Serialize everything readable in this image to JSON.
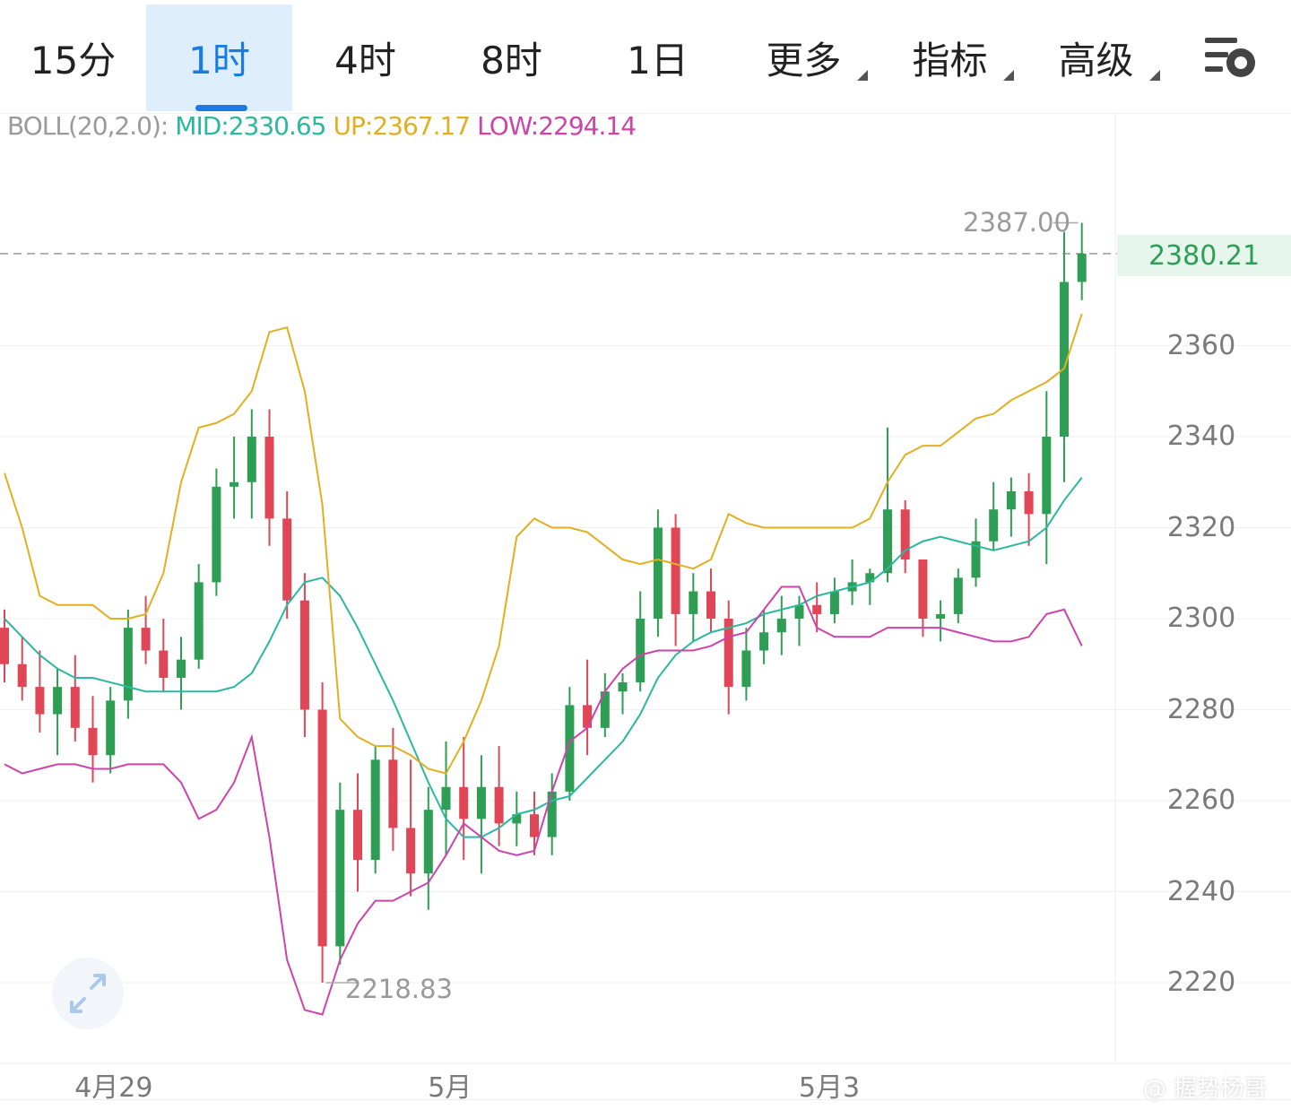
{
  "tabs": [
    {
      "label": "15分",
      "active": false,
      "dropdown": false
    },
    {
      "label": "1时",
      "active": true,
      "dropdown": false
    },
    {
      "label": "4时",
      "active": false,
      "dropdown": false
    },
    {
      "label": "8时",
      "active": false,
      "dropdown": false
    },
    {
      "label": "1日",
      "active": false,
      "dropdown": false
    },
    {
      "label": "更多",
      "active": false,
      "dropdown": true
    },
    {
      "label": "指标",
      "active": false,
      "dropdown": true
    },
    {
      "label": "高级",
      "active": false,
      "dropdown": true
    }
  ],
  "settings_icon": "chart-settings-icon",
  "indicator": {
    "name": "BOLL(20,2.0):",
    "mid": "MID:2330.65",
    "up": "UP:2367.17",
    "low": "LOW:2294.14",
    "colors": {
      "name": "#9a9a9a",
      "mid": "#2bb8a0",
      "up": "#e0b020",
      "low": "#cc44aa"
    }
  },
  "current_price": "2380.21",
  "high_label": "2387.00",
  "low_label": "2218.83",
  "watermark": "@ 握势杨哥",
  "expand_icon": "expand-arrows-icon",
  "colors": {
    "up": "#2e9e55",
    "down": "#e04656",
    "mid": "#2bb8a0",
    "upper": "#e0b020",
    "lower": "#cc44aa",
    "accent": "#1a7ce0"
  },
  "chart_data": {
    "type": "candlestick",
    "y_ticks": [
      "2360",
      "2340",
      "2320",
      "2300",
      "2280",
      "2260",
      "2240",
      "2220"
    ],
    "x_ticks": [
      "4月29",
      "5月",
      "5月3"
    ],
    "ylim": [
      2207,
      2390
    ],
    "grid": true,
    "series": [
      {
        "name": "MID",
        "values": [
          2300,
          2296,
          2292,
          2289,
          2287,
          2287,
          2286,
          2285,
          2284,
          2284,
          2284,
          2284,
          2284,
          2285,
          2288,
          2295,
          2303,
          2308,
          2309,
          2305,
          2298,
          2290,
          2282,
          2273,
          2264,
          2256,
          2252,
          2252,
          2254,
          2257,
          2258,
          2260,
          2261,
          2265,
          2269,
          2273,
          2279,
          2287,
          2292,
          2295,
          2297,
          2298,
          2299,
          2301,
          2302,
          2303,
          2305,
          2306,
          2307,
          2308,
          2311,
          2315,
          2317,
          2318,
          2317,
          2316,
          2315,
          2316,
          2317,
          2320,
          2326,
          2331
        ]
      },
      {
        "name": "UP",
        "values": [
          2332,
          2320,
          2305,
          2303,
          2303,
          2303,
          2300,
          2300,
          2301,
          2310,
          2330,
          2342,
          2343,
          2345,
          2350,
          2363,
          2364,
          2350,
          2325,
          2278,
          2274,
          2272,
          2272,
          2270,
          2267,
          2266,
          2273,
          2282,
          2294,
          2318,
          2322,
          2320,
          2320,
          2319,
          2316,
          2313,
          2312,
          2313,
          2312,
          2311,
          2313,
          2323,
          2321,
          2320,
          2320,
          2320,
          2320,
          2320,
          2320,
          2322,
          2330,
          2336,
          2338,
          2338,
          2341,
          2344,
          2345,
          2348,
          2350,
          2352,
          2355,
          2367
        ]
      },
      {
        "name": "LOW",
        "values": [
          2268,
          2266,
          2267,
          2268,
          2268,
          2267,
          2267,
          2268,
          2268,
          2268,
          2264,
          2256,
          2258,
          2264,
          2274,
          2252,
          2225,
          2214,
          2213,
          2225,
          2233,
          2238,
          2238,
          2240,
          2242,
          2248,
          2255,
          2252,
          2249,
          2248,
          2249,
          2262,
          2273,
          2276,
          2284,
          2289,
          2292,
          2293,
          2293,
          2293,
          2294,
          2296,
          2297,
          2302,
          2307,
          2307,
          2298,
          2296,
          2296,
          2296,
          2298,
          2298,
          2298,
          2298,
          2297,
          2296,
          2295,
          2295,
          2296,
          2301,
          2302,
          2294
        ]
      },
      {
        "name": "candles",
        "ohlc": [
          [
            2298,
            2302,
            2286,
            2290
          ],
          [
            2290,
            2296,
            2282,
            2285
          ],
          [
            2285,
            2293,
            2275,
            2279
          ],
          [
            2279,
            2289,
            2270,
            2285
          ],
          [
            2285,
            2292,
            2273,
            2276
          ],
          [
            2276,
            2283,
            2264,
            2270
          ],
          [
            2270,
            2285,
            2266,
            2282
          ],
          [
            2282,
            2302,
            2278,
            2298
          ],
          [
            2298,
            2305,
            2290,
            2293
          ],
          [
            2293,
            2300,
            2284,
            2287
          ],
          [
            2287,
            2296,
            2280,
            2291
          ],
          [
            2291,
            2312,
            2289,
            2308
          ],
          [
            2308,
            2333,
            2305,
            2329
          ],
          [
            2329,
            2340,
            2322,
            2330
          ],
          [
            2330,
            2346,
            2322,
            2340
          ],
          [
            2340,
            2346,
            2316,
            2322
          ],
          [
            2322,
            2328,
            2300,
            2304
          ],
          [
            2304,
            2310,
            2274,
            2280
          ],
          [
            2280,
            2286,
            2220,
            2228
          ],
          [
            2228,
            2264,
            2224,
            2258
          ],
          [
            2258,
            2266,
            2240,
            2247
          ],
          [
            2247,
            2272,
            2244,
            2269
          ],
          [
            2269,
            2276,
            2249,
            2254
          ],
          [
            2254,
            2269,
            2239,
            2244
          ],
          [
            2244,
            2263,
            2236,
            2258
          ],
          [
            2258,
            2273,
            2248,
            2263
          ],
          [
            2263,
            2274,
            2247,
            2256
          ],
          [
            2256,
            2270,
            2244,
            2263
          ],
          [
            2263,
            2272,
            2250,
            2255
          ],
          [
            2255,
            2262,
            2250,
            2257
          ],
          [
            2257,
            2262,
            2248,
            2252
          ],
          [
            2252,
            2266,
            2248,
            2262
          ],
          [
            2262,
            2285,
            2260,
            2281
          ],
          [
            2281,
            2291,
            2270,
            2276
          ],
          [
            2276,
            2288,
            2274,
            2284
          ],
          [
            2284,
            2288,
            2279,
            2286
          ],
          [
            2286,
            2306,
            2284,
            2300
          ],
          [
            2300,
            2324,
            2296,
            2320
          ],
          [
            2320,
            2323,
            2294,
            2301
          ],
          [
            2301,
            2310,
            2295,
            2306
          ],
          [
            2306,
            2311,
            2297,
            2300
          ],
          [
            2300,
            2304,
            2279,
            2285
          ],
          [
            2285,
            2298,
            2282,
            2293
          ],
          [
            2293,
            2302,
            2290,
            2297
          ],
          [
            2297,
            2305,
            2292,
            2300
          ],
          [
            2300,
            2305,
            2294,
            2303
          ],
          [
            2303,
            2308,
            2297,
            2301
          ],
          [
            2301,
            2309,
            2299,
            2306
          ],
          [
            2306,
            2313,
            2303,
            2308
          ],
          [
            2308,
            2311,
            2303,
            2310
          ],
          [
            2310,
            2342,
            2308,
            2324
          ],
          [
            2324,
            2326,
            2310,
            2313
          ],
          [
            2313,
            2312,
            2296,
            2300
          ],
          [
            2300,
            2304,
            2295,
            2301
          ],
          [
            2301,
            2311,
            2299,
            2309
          ],
          [
            2309,
            2322,
            2307,
            2317
          ],
          [
            2317,
            2330,
            2315,
            2324
          ],
          [
            2324,
            2331,
            2318,
            2328
          ],
          [
            2328,
            2332,
            2316,
            2323
          ],
          [
            2323,
            2350,
            2312,
            2340
          ],
          [
            2340,
            2385,
            2330,
            2374
          ],
          [
            2374,
            2387,
            2370,
            2380.21
          ]
        ]
      }
    ]
  }
}
